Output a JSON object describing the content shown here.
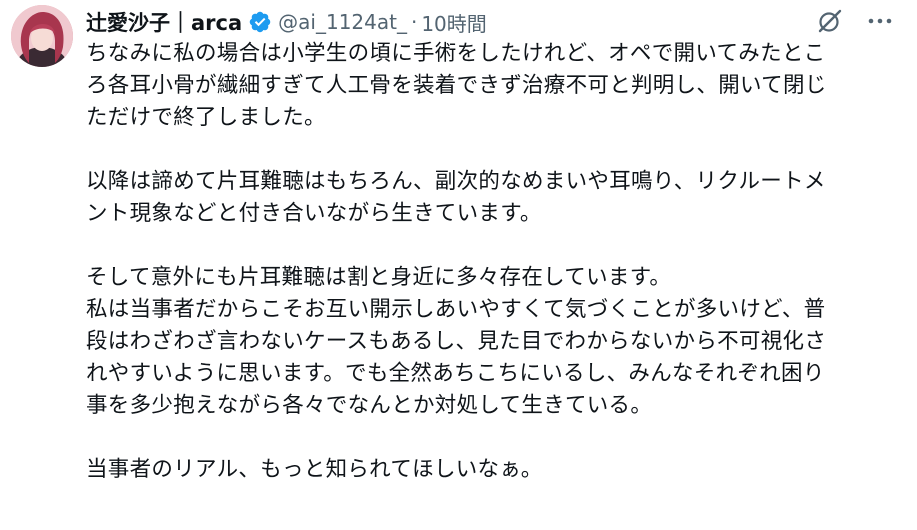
{
  "author": {
    "display_name": "辻愛沙子｜arca",
    "handle": "@ai_1124at_",
    "separator": "·",
    "time": "10時間"
  },
  "icons": {
    "avatar": "avatar",
    "verified": "verified-badge-icon",
    "grok": "grok-icon",
    "more": "more-icon"
  },
  "colors": {
    "verified": "#1d9bf0",
    "secondary_text": "#536471",
    "primary_text": "#0f1419"
  },
  "paragraphs": [
    {
      "lines": [
        "ちなみに私の場合は小学生の頃に手術をしたけれど、オペで開いてみたとこ",
        "ろ各耳小骨が繊細すぎて人工骨を装着できず治療不可と判明し、開いて閉じ",
        "ただけで終了しました。"
      ]
    },
    {
      "lines": [
        "以降は諦めて片耳難聴はもちろん、副次的なめまいや耳鳴り、リクルートメ",
        "ント現象などと付き合いながら生きています。"
      ]
    },
    {
      "lines": [
        "そして意外にも片耳難聴は割と身近に多々存在しています。",
        "私は当事者だからこそお互い開示しあいやすくて気づくことが多いけど、普",
        "段はわざわざ言わないケースもあるし、見た目でわからないから不可視化さ",
        "れやすいように思います。でも全然あちこちにいるし、みんなそれぞれ困り",
        "事を多少抱えながら各々でなんとか対処して生きている。"
      ]
    },
    {
      "lines": [
        "当事者のリアル、もっと知られてほしいなぁ。"
      ]
    }
  ]
}
